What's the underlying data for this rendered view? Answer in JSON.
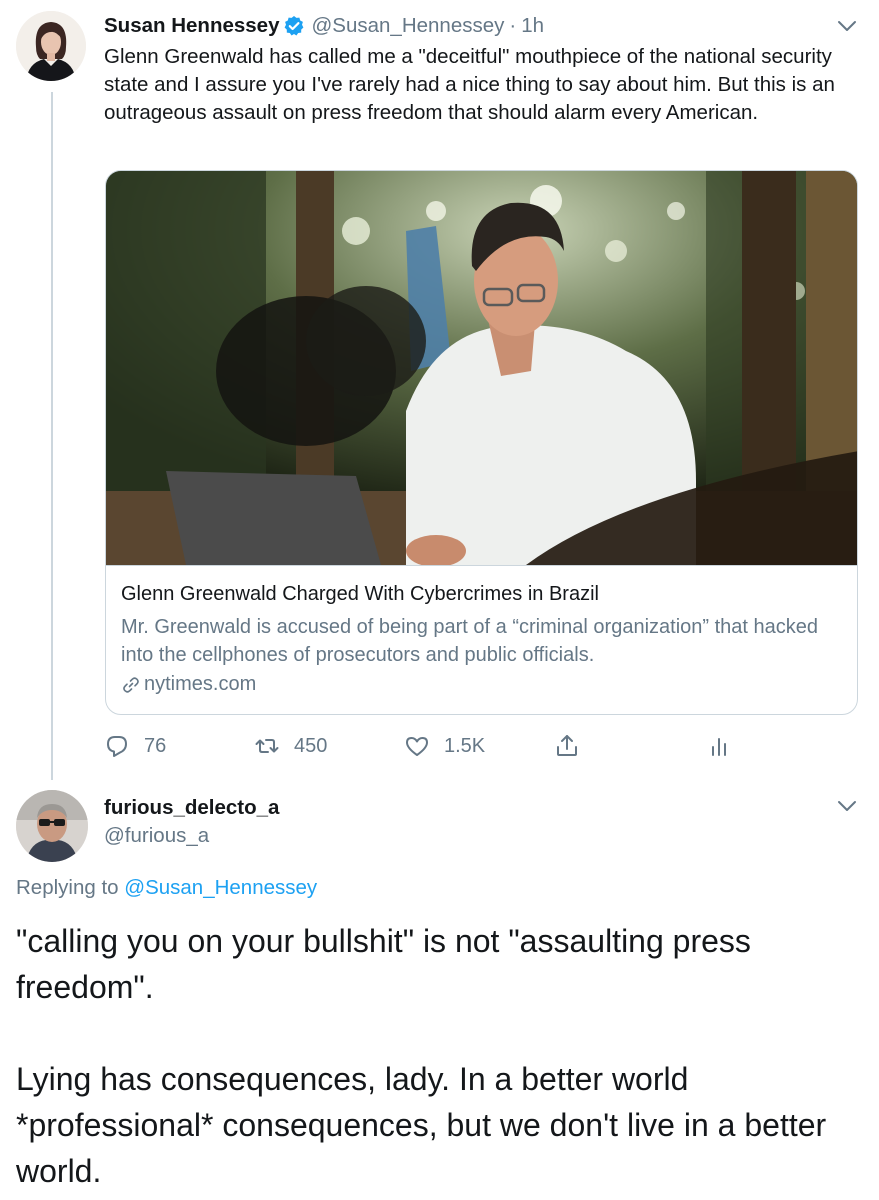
{
  "tweet": {
    "author": {
      "name": "Susan Hennessey",
      "handle": "@Susan_Hennessey",
      "verified": true
    },
    "separator": "·",
    "time": "1h",
    "text": "Glenn Greenwald has called me a \"deceitful\" mouthpiece of the national security state and I assure you I've rarely had a nice thing to say about him. But this is an outrageous assault on press freedom that should alarm every American.",
    "card": {
      "title": "Glenn Greenwald Charged With Cybercrimes in Brazil",
      "description": "Mr. Greenwald is accused of being part of a “criminal organization” that hacked into the cellphones of prosecutors and public officials.",
      "domain": "nytimes.com",
      "icon": "link-icon"
    },
    "actions": {
      "replies": "76",
      "retweets": "450",
      "likes": "1.5K"
    }
  },
  "reply": {
    "author": {
      "name": "furious_delecto_a",
      "handle": "@furious_a"
    },
    "replying_prefix": "Replying to",
    "replying_to": "@Susan_Hennessey",
    "paragraphs": [
      "\"calling you on your bullshit\" is not \"assaulting press freedom\".",
      "Lying has consequences, lady.  In a better world *professional* consequences, but we don't live in a better world."
    ]
  },
  "colors": {
    "accent": "#1da1f2",
    "text": "#14171a",
    "secondary": "#657786",
    "border": "#ccd6dd"
  }
}
